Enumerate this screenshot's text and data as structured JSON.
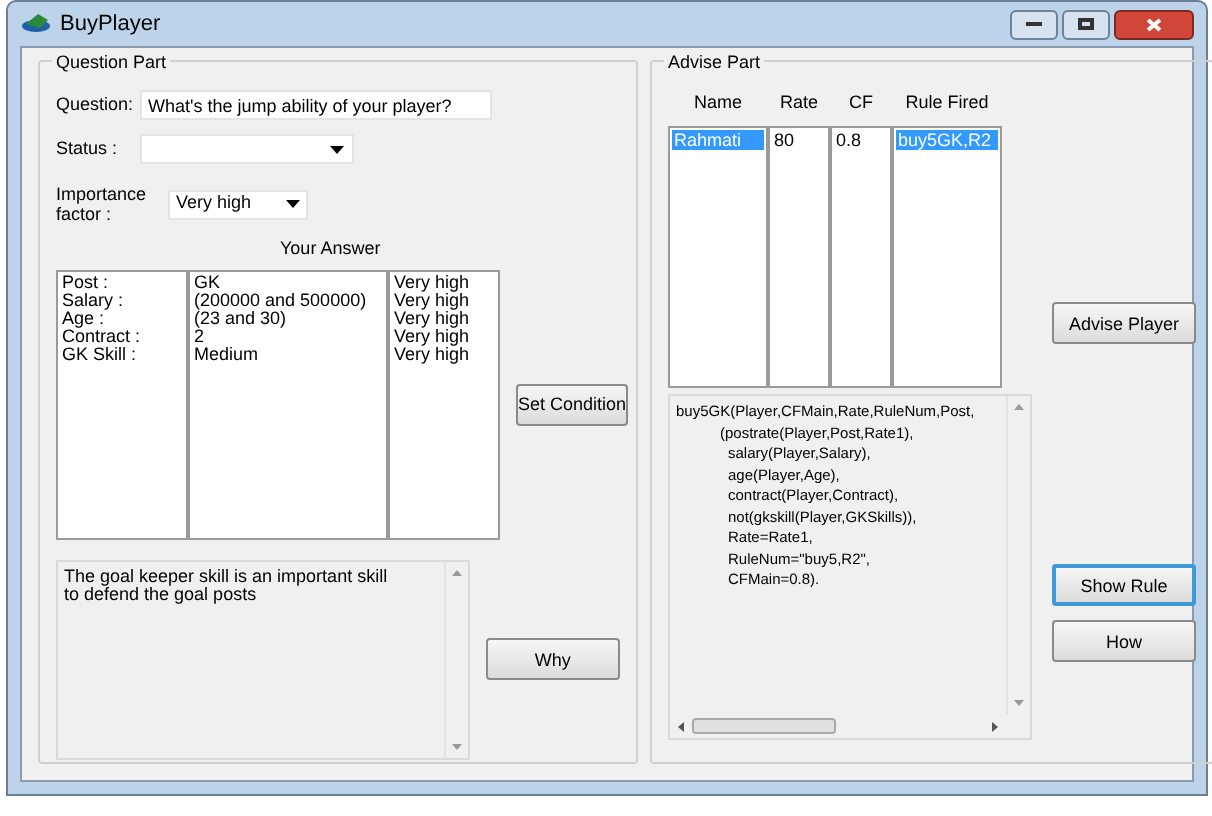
{
  "window": {
    "title": "BuyPlayer"
  },
  "question_part": {
    "title": "Question Part",
    "question": {
      "label": "Question:",
      "value": "What's the jump ability of your player?"
    },
    "status": {
      "label": "Status :"
    },
    "importance": {
      "label": "Importance factor :",
      "value": "Very high"
    },
    "answer_title": "Your Answer",
    "answers": [
      {
        "attribute": "Post :",
        "value": "GK",
        "importance": "Very high"
      },
      {
        "attribute": "Salary :",
        "value": "(200000 and 500000)",
        "importance": "Very high"
      },
      {
        "attribute": "Age :",
        "value": "(23 and 30)",
        "importance": "Very high"
      },
      {
        "attribute": "Contract :",
        "value": "2",
        "importance": "Very high"
      },
      {
        "attribute": "GK Skill :",
        "value": "Medium",
        "importance": "Very high"
      }
    ],
    "set_condition_button": {
      "label": "Set Condition",
      "focused": false
    },
    "explanation": [
      "The goal keeper skill is an important skill",
      "to defend the goal posts"
    ],
    "why_button": {
      "label": "Why",
      "focused": false
    }
  },
  "advise_part": {
    "title": "Advise Part",
    "columns": [
      "Name",
      "Rate",
      "CF",
      "Rule Fired"
    ],
    "rows": [
      {
        "cells": [
          "Rahmati",
          "80",
          "0.8",
          "buy5GK,R2"
        ],
        "selected": true
      }
    ],
    "advise_button": {
      "label": "Advise Player",
      "focused": false
    },
    "rule_lines": [
      "buy5GK(Player,CFMain,Rate,RuleNum,Post,",
      "(postrate(Player,Post,Rate1),",
      "salary(Player,Salary),",
      "age(Player,Age),",
      "contract(Player,Contract),",
      "not(gkskill(Player,GKSkills)),",
      "Rate=Rate1,",
      "RuleNum=\"buy5,R2\",",
      "CFMain=0.8)."
    ],
    "show_rule_button": {
      "label": "Show Rule",
      "focused": true
    },
    "how_button": {
      "label": "How",
      "focused": false
    }
  }
}
